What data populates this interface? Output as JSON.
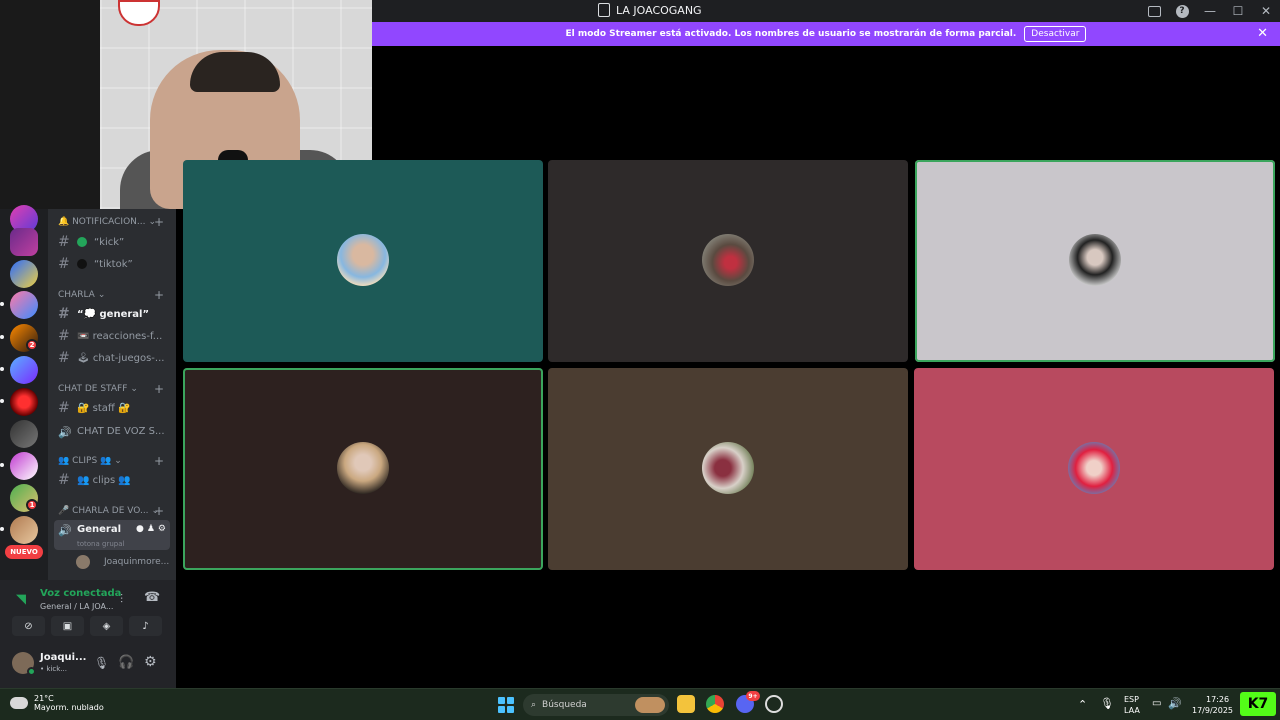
{
  "window": {
    "title": "LA JOACOGANG"
  },
  "banner": {
    "text": "El modo Streamer está activado. Los nombres de usuario se mostrarán de forma parcial.",
    "button": "Desactivar"
  },
  "servers": {
    "badges": [
      "2",
      "1"
    ],
    "new_label": "NUEVO"
  },
  "sidebar": {
    "categories": {
      "notificaciones": "🔔 NOTIFICACION...",
      "charla": "CHARLA",
      "staff": "CHAT DE STAFF",
      "clips": "👥 CLIPS 👥",
      "charla_voz": "🎤 CHARLA DE VO..."
    },
    "channels": {
      "kick": "“kick”",
      "tiktok": "“tiktok”",
      "general": "“💭 general”",
      "reacciones": "📼 reacciones-f...",
      "chat_juegos": "🕹 chat-juegos-...",
      "staff": "🔐 staff 🔐",
      "chat_voz": "CHAT DE VOZ S...",
      "clips": "👥 clips 👥",
      "voice_general": "General",
      "voice_general_sub": "totona grupal"
    },
    "member": "Joaquinmore..."
  },
  "voice_panel": {
    "status": "Voz conectada",
    "location": "General / LA JOA..."
  },
  "user": {
    "name": "Joaqui...",
    "sub": "• kick..."
  },
  "grid": {
    "tiles": [
      {
        "bg": "#1d5a57",
        "speaking": false
      },
      {
        "bg": "#2e2a2a",
        "speaking": false
      },
      {
        "bg": "#c9c6cb",
        "speaking": true
      },
      {
        "bg": "#2d211f",
        "speaking": true
      },
      {
        "bg": "#4b3d31",
        "speaking": false
      },
      {
        "bg": "#b84a5f",
        "speaking": false
      }
    ]
  },
  "taskbar": {
    "weather_temp": "21°C",
    "weather_desc": "Mayorm. nublado",
    "search": "Búsqueda",
    "discord_badge": "9+",
    "lang1": "ESP",
    "lang2": "LAA",
    "time": "17:26",
    "date": "17/9/2025",
    "brand": "K7"
  },
  "colors": {
    "accent": "#9147ff",
    "online": "#23a55a",
    "speaking": "#3ba55d"
  }
}
